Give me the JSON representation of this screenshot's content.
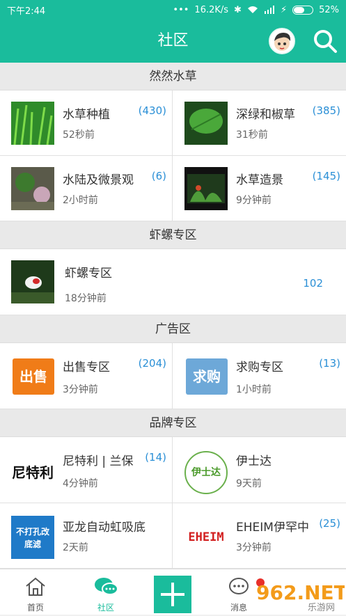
{
  "status_bar": {
    "time": "下午2:44",
    "speed": "16.2K/s",
    "battery": "52%",
    "battery_level": 0.52
  },
  "header": {
    "title": "社区"
  },
  "sections": [
    {
      "title": "然然水草"
    },
    {
      "title": "虾螺专区"
    },
    {
      "title": "广告区"
    },
    {
      "title": "品牌专区"
    }
  ],
  "forums": {
    "f1": {
      "name": "水草种植",
      "time": "52秒前",
      "count": "(430)"
    },
    "f2": {
      "name": "深绿和椒草",
      "time": "31秒前",
      "count": "(385)"
    },
    "f3": {
      "name": "水陆及微景观",
      "time": "2小时前",
      "count": "(6)"
    },
    "f4": {
      "name": "水草造景",
      "time": "9分钟前",
      "count": "(145)"
    },
    "f5": {
      "name": "虾螺专区",
      "time": "18分钟前",
      "count": "102"
    },
    "f6": {
      "name": "出售专区",
      "time": "3分钟前",
      "count": "(204)",
      "thumb_text": "出售"
    },
    "f7": {
      "name": "求购专区",
      "time": "1小时前",
      "count": "(13)",
      "thumb_text": "求购"
    },
    "f8": {
      "name": "尼特利 | 兰保",
      "time": "4分钟前",
      "count": "(14)",
      "thumb_text": "尼特利"
    },
    "f9": {
      "name": "伊士达",
      "time": "9天前",
      "count": "",
      "thumb_text": "伊士达"
    },
    "f10": {
      "name": "亚龙自动虹吸底",
      "time": "2天前",
      "count": "",
      "thumb_text": "不打孔改底滤"
    },
    "f11": {
      "name": "EHEIM伊罕中",
      "time": "3分钟前",
      "count": "(25)",
      "thumb_text": "EHEIM"
    }
  },
  "tabs": {
    "home": "首页",
    "community": "社区",
    "messages": "消息"
  },
  "watermark": {
    "text": "962.NET",
    "sub": "乐游网"
  },
  "colors": {
    "primary": "#1abc9c",
    "count": "#2a8fd6"
  }
}
